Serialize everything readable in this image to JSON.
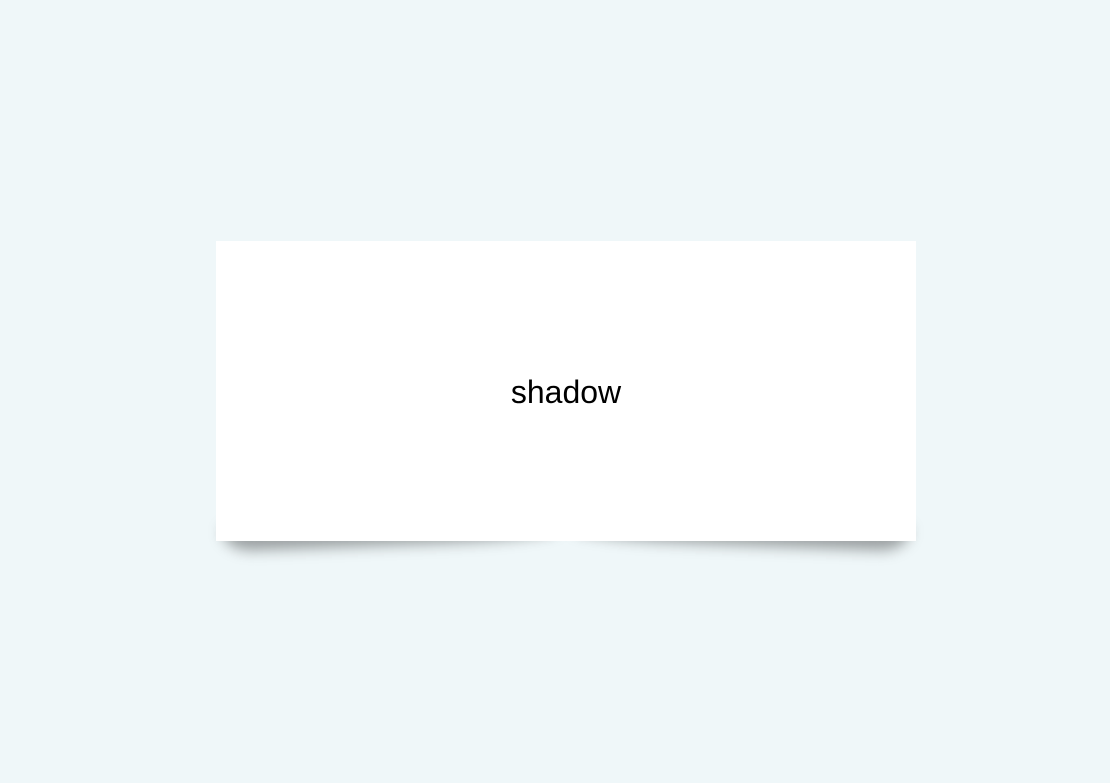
{
  "card": {
    "label": "shadow"
  },
  "colors": {
    "background": "#eff7f9",
    "card": "#ffffff",
    "text": "#000000"
  }
}
